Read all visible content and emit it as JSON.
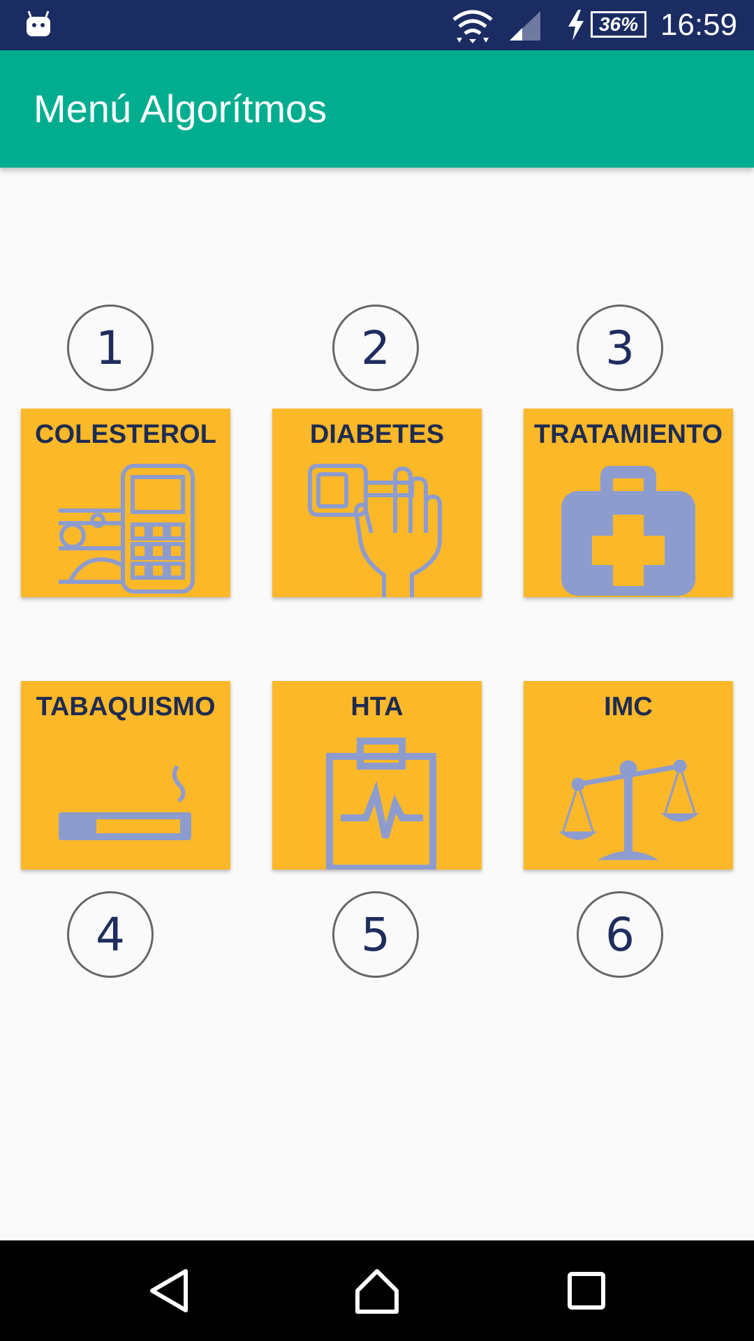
{
  "status_bar": {
    "time": "16:59",
    "battery": "36%",
    "icons": [
      "android-icon",
      "wifi-icon",
      "signal-icon",
      "charging-icon",
      "battery-icon"
    ]
  },
  "toolbar": {
    "title": "Menú Algorítmos"
  },
  "items": [
    {
      "number": "1",
      "label": "COLESTEROL",
      "icon": "cholesterol-meter-icon"
    },
    {
      "number": "2",
      "label": "DIABETES",
      "icon": "glucometer-hand-icon"
    },
    {
      "number": "3",
      "label": "TRATAMIENTO",
      "icon": "medical-kit-icon"
    },
    {
      "number": "4",
      "label": "TABAQUISMO",
      "icon": "cigarette-icon"
    },
    {
      "number": "5",
      "label": "HTA",
      "icon": "clipboard-heartbeat-icon"
    },
    {
      "number": "6",
      "label": "IMC",
      "icon": "scale-icon"
    }
  ],
  "colors": {
    "status_bar": "#1b2c63",
    "toolbar": "#00ad8e",
    "tile": "#fbb829",
    "icon": "#8d9ccf",
    "label": "#1e2b52"
  },
  "nav_bar": {
    "icons": [
      "back-icon",
      "home-icon",
      "recents-icon"
    ]
  }
}
